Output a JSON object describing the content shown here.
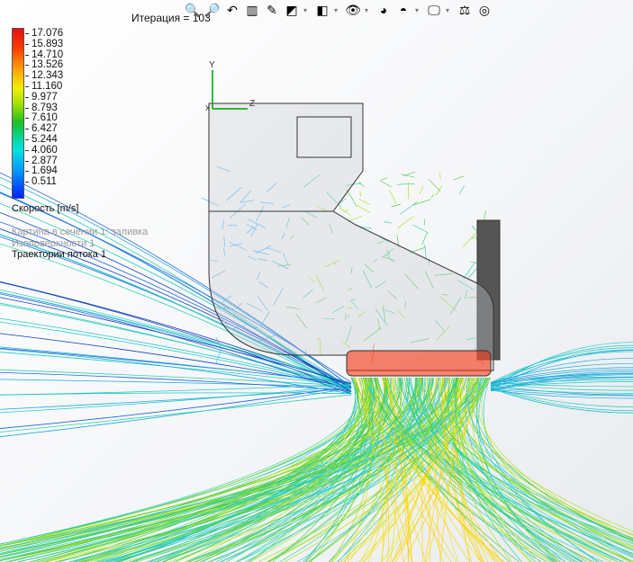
{
  "header": {
    "iteration_label": "Итерация = 103"
  },
  "toolbar": {
    "icons": [
      "zoom-to-fit-icon",
      "zoom-area-icon",
      "previous-view-icon",
      "section-view-icon",
      "dynamic-annotation-icon",
      "view-orientation-icon",
      "display-style-icon",
      "hide-show-icon",
      "edit-appearance-icon",
      "apply-scene-icon",
      "view-settings-icon",
      "balance-icon",
      "flow-results-icon"
    ]
  },
  "legend": {
    "values": [
      "17.076",
      "15.893",
      "14.710",
      "13.526",
      "12.343",
      "11.160",
      "9.977",
      "8.793",
      "7.610",
      "6.427",
      "5.244",
      "4.060",
      "2.877",
      "1.694",
      "0.511"
    ],
    "unit": "Скорость [m/s]",
    "min": 0.511,
    "max": 17.076
  },
  "features": [
    {
      "label": "Картина в сечении 1: заливка",
      "active": false
    },
    {
      "label": "Изоповерхности 1",
      "active": false
    },
    {
      "label": "Траектории потока 1",
      "active": true
    }
  ],
  "axes": {
    "y": "Y",
    "z": "Z",
    "x": "X"
  },
  "colors": {
    "triad": "#00a000",
    "plate": "#555555",
    "hot": "#ff2000"
  }
}
